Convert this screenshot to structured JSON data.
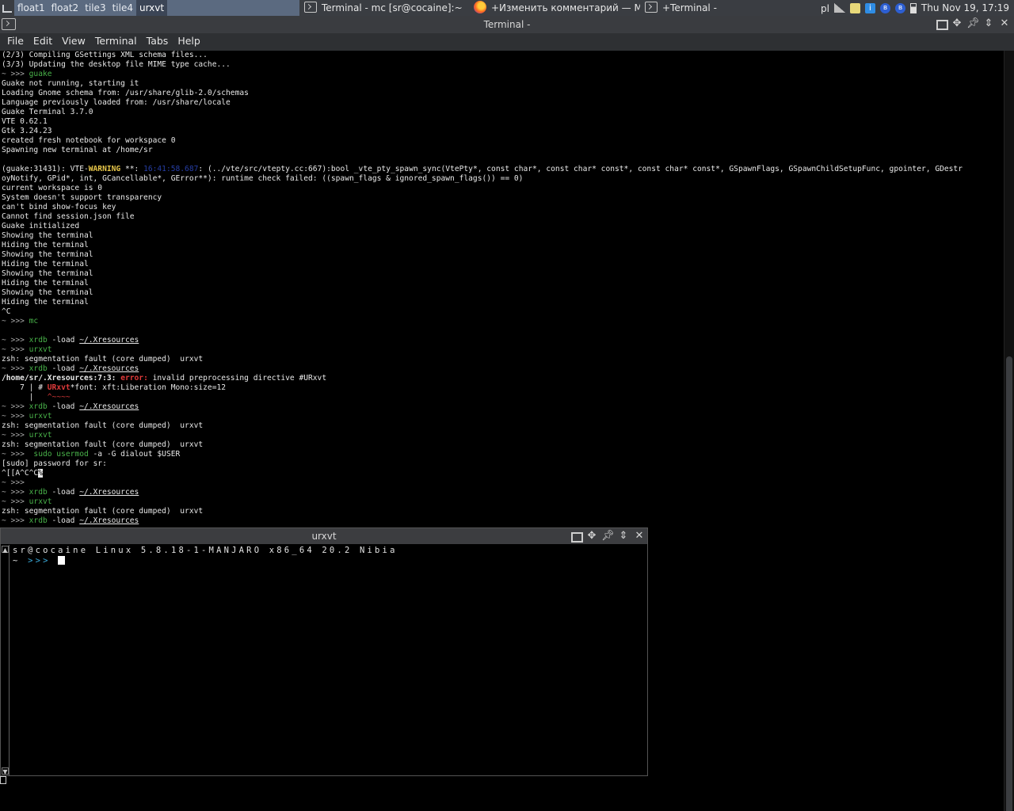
{
  "panel": {
    "workspaces": [
      {
        "label": "float1",
        "active": true
      },
      {
        "label": "float2",
        "active": false
      },
      {
        "label": "tile3",
        "active": false
      },
      {
        "label": "tile4",
        "active": false
      },
      {
        "label": "urxvt",
        "active": true
      }
    ],
    "tasks": [
      {
        "label": "Terminal - mc [sr@cocaine]:~",
        "icon": "terminal-icon"
      },
      {
        "label": "+Изменить комментарий — M...",
        "icon": "firefox-icon"
      },
      {
        "label": "+Terminal -",
        "icon": "terminal-icon"
      }
    ],
    "tray": {
      "keyboard_layout": "pl",
      "clock": "Thu Nov 19, 17:19"
    }
  },
  "window": {
    "title": "Terminal -",
    "menu": [
      "File",
      "Edit",
      "View",
      "Terminal",
      "Tabs",
      "Help"
    ]
  },
  "terminal_lines": [
    [
      {
        "t": "(2/3) Compiling GSettings XML schema files..."
      }
    ],
    [
      {
        "t": "(3/3) Updating the desktop file MIME type cache..."
      }
    ],
    [
      {
        "t": "~ >>> ",
        "c": "pr"
      },
      {
        "t": "guake",
        "c": "g"
      }
    ],
    [
      {
        "t": "Guake not running, starting it"
      }
    ],
    [
      {
        "t": "Loading Gnome schema from: /usr/share/glib-2.0/schemas"
      }
    ],
    [
      {
        "t": "Language previously loaded from: /usr/share/locale"
      }
    ],
    [
      {
        "t": "Guake Terminal 3.7.0"
      }
    ],
    [
      {
        "t": "VTE 0.62.1"
      }
    ],
    [
      {
        "t": "Gtk 3.24.23"
      }
    ],
    [
      {
        "t": "created fresh notebook for workspace 0"
      }
    ],
    [
      {
        "t": "Spawning new terminal at /home/sr"
      }
    ],
    [
      {
        "t": ""
      }
    ],
    [
      {
        "t": "(guake:31431): VTE-"
      },
      {
        "t": "WARNING",
        "c": "yel"
      },
      {
        "t": " **: "
      },
      {
        "t": "16:41:58.687",
        "c": "ts"
      },
      {
        "t": ": (../vte/src/vtepty.cc:667):bool _vte_pty_spawn_sync(VtePty*, const char*, const char* const*, const char* const*, GSpawnFlags, GSpawnChildSetupFunc, gpointer, GDestr"
      }
    ],
    [
      {
        "t": "oyNotify, GPid*, int, GCancellable*, GError**): runtime check failed: ((spawn_flags & ignored_spawn_flags()) == 0)"
      }
    ],
    [
      {
        "t": "current workspace is 0"
      }
    ],
    [
      {
        "t": "System doesn't support transparency"
      }
    ],
    [
      {
        "t": "can't bind show-focus key"
      }
    ],
    [
      {
        "t": "Cannot find session.json file"
      }
    ],
    [
      {
        "t": "Guake initialized"
      }
    ],
    [
      {
        "t": "Showing the terminal"
      }
    ],
    [
      {
        "t": "Hiding the terminal"
      }
    ],
    [
      {
        "t": "Showing the terminal"
      }
    ],
    [
      {
        "t": "Hiding the terminal"
      }
    ],
    [
      {
        "t": "Showing the terminal"
      }
    ],
    [
      {
        "t": "Hiding the terminal"
      }
    ],
    [
      {
        "t": "Showing the terminal"
      }
    ],
    [
      {
        "t": "Hiding the terminal"
      }
    ],
    [
      {
        "t": "^C"
      }
    ],
    [
      {
        "t": "~ >>> ",
        "c": "pr"
      },
      {
        "t": "mc",
        "c": "g"
      }
    ],
    [
      {
        "t": ""
      }
    ],
    [
      {
        "t": "~ >>> ",
        "c": "pr"
      },
      {
        "t": "xrdb",
        "c": "g"
      },
      {
        "t": " -load "
      },
      {
        "t": "~/.Xresources",
        "c": "u"
      }
    ],
    [
      {
        "t": "~ >>> ",
        "c": "pr"
      },
      {
        "t": "urxvt",
        "c": "g"
      }
    ],
    [
      {
        "t": "zsh: segmentation fault (core dumped)  urxvt"
      }
    ],
    [
      {
        "t": "~ >>> ",
        "c": "pr"
      },
      {
        "t": "xrdb",
        "c": "g"
      },
      {
        "t": " -load "
      },
      {
        "t": "~/.Xresources",
        "c": "u"
      }
    ],
    [
      {
        "t": "/home/sr/.Xresources:7:3: ",
        "c": "bold"
      },
      {
        "t": "error:",
        "c": "red bold"
      },
      {
        "t": " invalid preprocessing directive #URxvt"
      }
    ],
    [
      {
        "t": "    7 | # "
      },
      {
        "t": "URxvt",
        "c": "red bold"
      },
      {
        "t": "*font: xft:Liberation Mono:size=12"
      }
    ],
    [
      {
        "t": "      |   "
      },
      {
        "t": "^~~~~",
        "c": "red"
      }
    ],
    [
      {
        "t": "~ >>> ",
        "c": "pr"
      },
      {
        "t": "xrdb",
        "c": "g"
      },
      {
        "t": " -load "
      },
      {
        "t": "~/.Xresources",
        "c": "u"
      }
    ],
    [
      {
        "t": "~ >>> ",
        "c": "pr"
      },
      {
        "t": "urxvt",
        "c": "g"
      }
    ],
    [
      {
        "t": "zsh: segmentation fault (core dumped)  urxvt"
      }
    ],
    [
      {
        "t": "~ >>> ",
        "c": "pr"
      },
      {
        "t": "urxvt",
        "c": "g"
      }
    ],
    [
      {
        "t": "zsh: segmentation fault (core dumped)  urxvt"
      }
    ],
    [
      {
        "t": "~ >>> ",
        "c": "pr"
      },
      {
        "t": " sudo usermod",
        "c": "g"
      },
      {
        "t": " -a -G dialout $USER"
      }
    ],
    [
      {
        "t": "[sudo] password for sr:"
      }
    ],
    [
      {
        "t": "^[[A^C^C"
      },
      {
        "t": "%",
        "c": "cur"
      }
    ],
    [
      {
        "t": "~ >>>",
        "c": "pr"
      }
    ],
    [
      {
        "t": "~ >>> ",
        "c": "pr"
      },
      {
        "t": "xrdb",
        "c": "g"
      },
      {
        "t": " -load "
      },
      {
        "t": "~/.Xresources",
        "c": "u"
      }
    ],
    [
      {
        "t": "~ >>> ",
        "c": "pr"
      },
      {
        "t": "urxvt",
        "c": "g"
      }
    ],
    [
      {
        "t": "zsh: segmentation fault (core dumped)  urxvt"
      }
    ],
    [
      {
        "t": "~ >>> ",
        "c": "pr"
      },
      {
        "t": "xrdb",
        "c": "g"
      },
      {
        "t": " -load "
      },
      {
        "t": "~/.Xresources",
        "c": "u"
      }
    ]
  ],
  "urxvt": {
    "title": "urxvt",
    "line1": "sr@cocaine Linux 5.8.18-1-MANJARO x86_64 20.2 Nibia",
    "prompt_tilde": "~",
    "prompt_chevrons": ">>>"
  },
  "colors": {
    "workspace_bar": "#5b6a80",
    "prompt_green": "#49b34a",
    "error_red": "#e03a3a",
    "warning_yellow": "#e9c84a"
  }
}
